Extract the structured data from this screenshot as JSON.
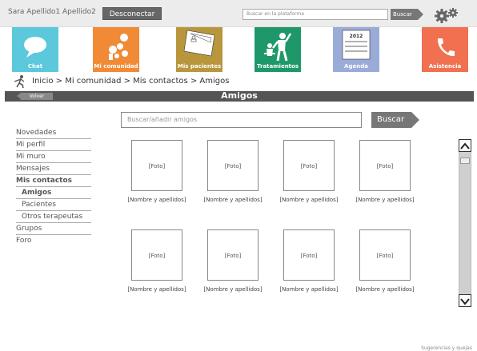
{
  "topbar": {
    "user_name": "Sara Apellido1 Apellido2",
    "logout_label": "Desconectar",
    "search_placeholder": "Buscar en la plataforma",
    "search_label": "Buscar"
  },
  "tiles": [
    {
      "label": "Chat",
      "color": "#5bc8dc",
      "icon": "chat-bubble-icon"
    },
    {
      "label": "Mi comunidad",
      "color": "#f08a35",
      "icon": "community-icon"
    },
    {
      "label": "Mis pacientes",
      "color": "#b8963c",
      "icon": "patients-folder-icon"
    },
    {
      "label": "Tratamientos",
      "color": "#1e9868",
      "icon": "treatments-icon"
    },
    {
      "label": "Agenda",
      "color": "#9aabd8",
      "icon": "calendar-icon",
      "year": "2012"
    },
    {
      "label": "Asistencia",
      "color": "#f07050",
      "icon": "phone-icon"
    }
  ],
  "breadcrumb": "Inicio > Mi comunidad > Mis contactos > Amigos",
  "titlebar": {
    "back_label": "Volver",
    "title": "Amigos"
  },
  "sidebar": {
    "items": [
      {
        "label": "Novedades"
      },
      {
        "label": "Mi perfil"
      },
      {
        "label": "Mi muro"
      },
      {
        "label": "Mensajes"
      },
      {
        "label": "Mis contactos"
      },
      {
        "label": "Amigos"
      },
      {
        "label": "Pacientes"
      },
      {
        "label": "Otros terapeutas"
      },
      {
        "label": "Grupos"
      },
      {
        "label": "Foro"
      }
    ]
  },
  "search": {
    "placeholder": "Buscar/añadir amigos",
    "button_label": "Buscar"
  },
  "friends": [
    {
      "photo": "[Foto]",
      "name": "[Nombre y apellidos]"
    },
    {
      "photo": "[Foto]",
      "name": "[Nombre y apellidos]"
    },
    {
      "photo": "[Foto]",
      "name": "[Nombre y apellidos]"
    },
    {
      "photo": "[Foto]",
      "name": "[Nombre y apellidos]"
    },
    {
      "photo": "[Foto]",
      "name": "[Nombre y apellidos]"
    },
    {
      "photo": "[Foto]",
      "name": "[Nombre y apellidos]"
    },
    {
      "photo": "[Foto]",
      "name": "[Nombre y apellidos]"
    },
    {
      "photo": "[Foto]",
      "name": "[Nombre y apellidos]"
    }
  ],
  "footer": {
    "link": "Sugerencias y quejas"
  }
}
